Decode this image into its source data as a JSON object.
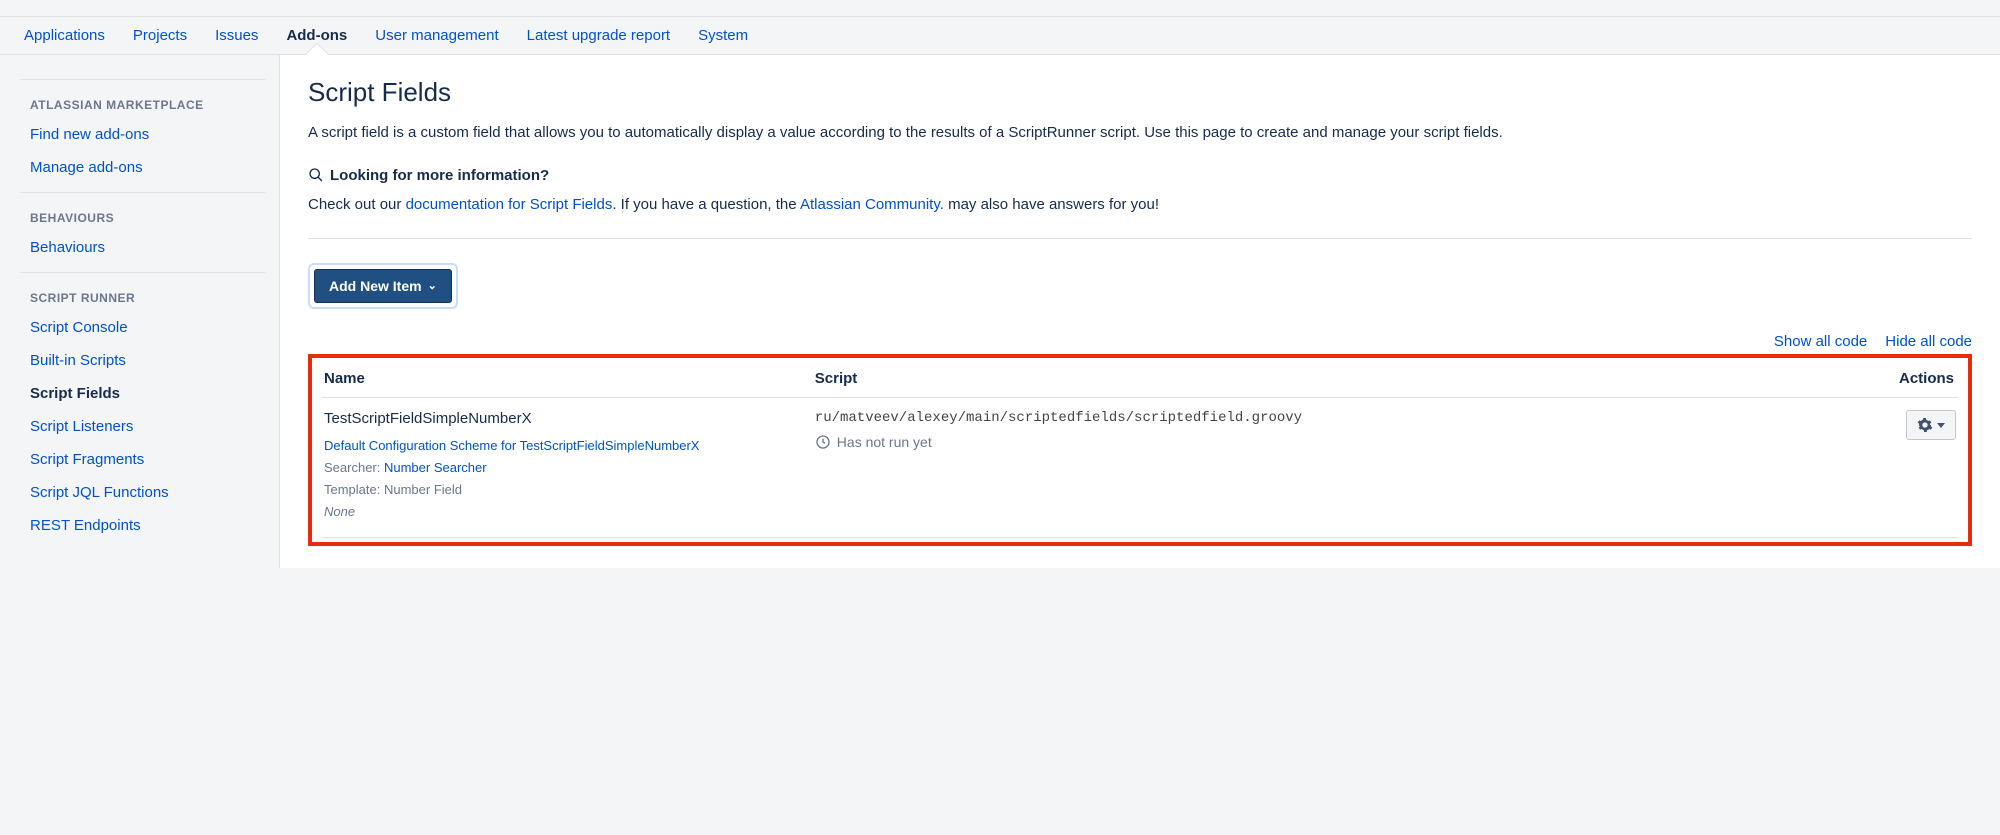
{
  "topnav": {
    "items": [
      {
        "label": "Applications"
      },
      {
        "label": "Projects"
      },
      {
        "label": "Issues"
      },
      {
        "label": "Add-ons",
        "active": true
      },
      {
        "label": "User management"
      },
      {
        "label": "Latest upgrade report"
      },
      {
        "label": "System"
      }
    ]
  },
  "sidebar": {
    "sections": [
      {
        "heading": "ATLASSIAN MARKETPLACE",
        "items": [
          {
            "label": "Find new add-ons"
          },
          {
            "label": "Manage add-ons"
          }
        ]
      },
      {
        "heading": "BEHAVIOURS",
        "items": [
          {
            "label": "Behaviours"
          }
        ]
      },
      {
        "heading": "SCRIPT RUNNER",
        "items": [
          {
            "label": "Script Console"
          },
          {
            "label": "Built-in Scripts"
          },
          {
            "label": "Script Fields",
            "active": true
          },
          {
            "label": "Script Listeners"
          },
          {
            "label": "Script Fragments"
          },
          {
            "label": "Script JQL Functions"
          },
          {
            "label": "REST Endpoints"
          }
        ]
      }
    ]
  },
  "main": {
    "title": "Script Fields",
    "description": "A script field is a custom field that allows you to automatically display a value according to the results of a ScriptRunner script. Use this page to create and manage your script fields.",
    "info_heading": "Looking for more information?",
    "info_prefix": "Check out our ",
    "info_link1": "documentation for Script Fields",
    "info_mid": ". If you have a question, the ",
    "info_link2": "Atlassian Community.",
    "info_suffix": " may also have answers for you!",
    "add_button": "Add New Item",
    "show_all": "Show all code",
    "hide_all": "Hide all code",
    "columns": {
      "name": "Name",
      "script": "Script",
      "actions": "Actions"
    },
    "rows": [
      {
        "name": "TestScriptFieldSimpleNumberX",
        "config_link": "Default Configuration Scheme for TestScriptFieldSimpleNumberX",
        "searcher_label": "Searcher: ",
        "searcher_value": "Number Searcher",
        "template_label": "Template: ",
        "template_value": "Number Field",
        "context": "None",
        "script_path": "ru/matveev/alexey/main/scriptedfields/scriptedfield.groovy",
        "run_status": "Has not run yet"
      }
    ]
  }
}
